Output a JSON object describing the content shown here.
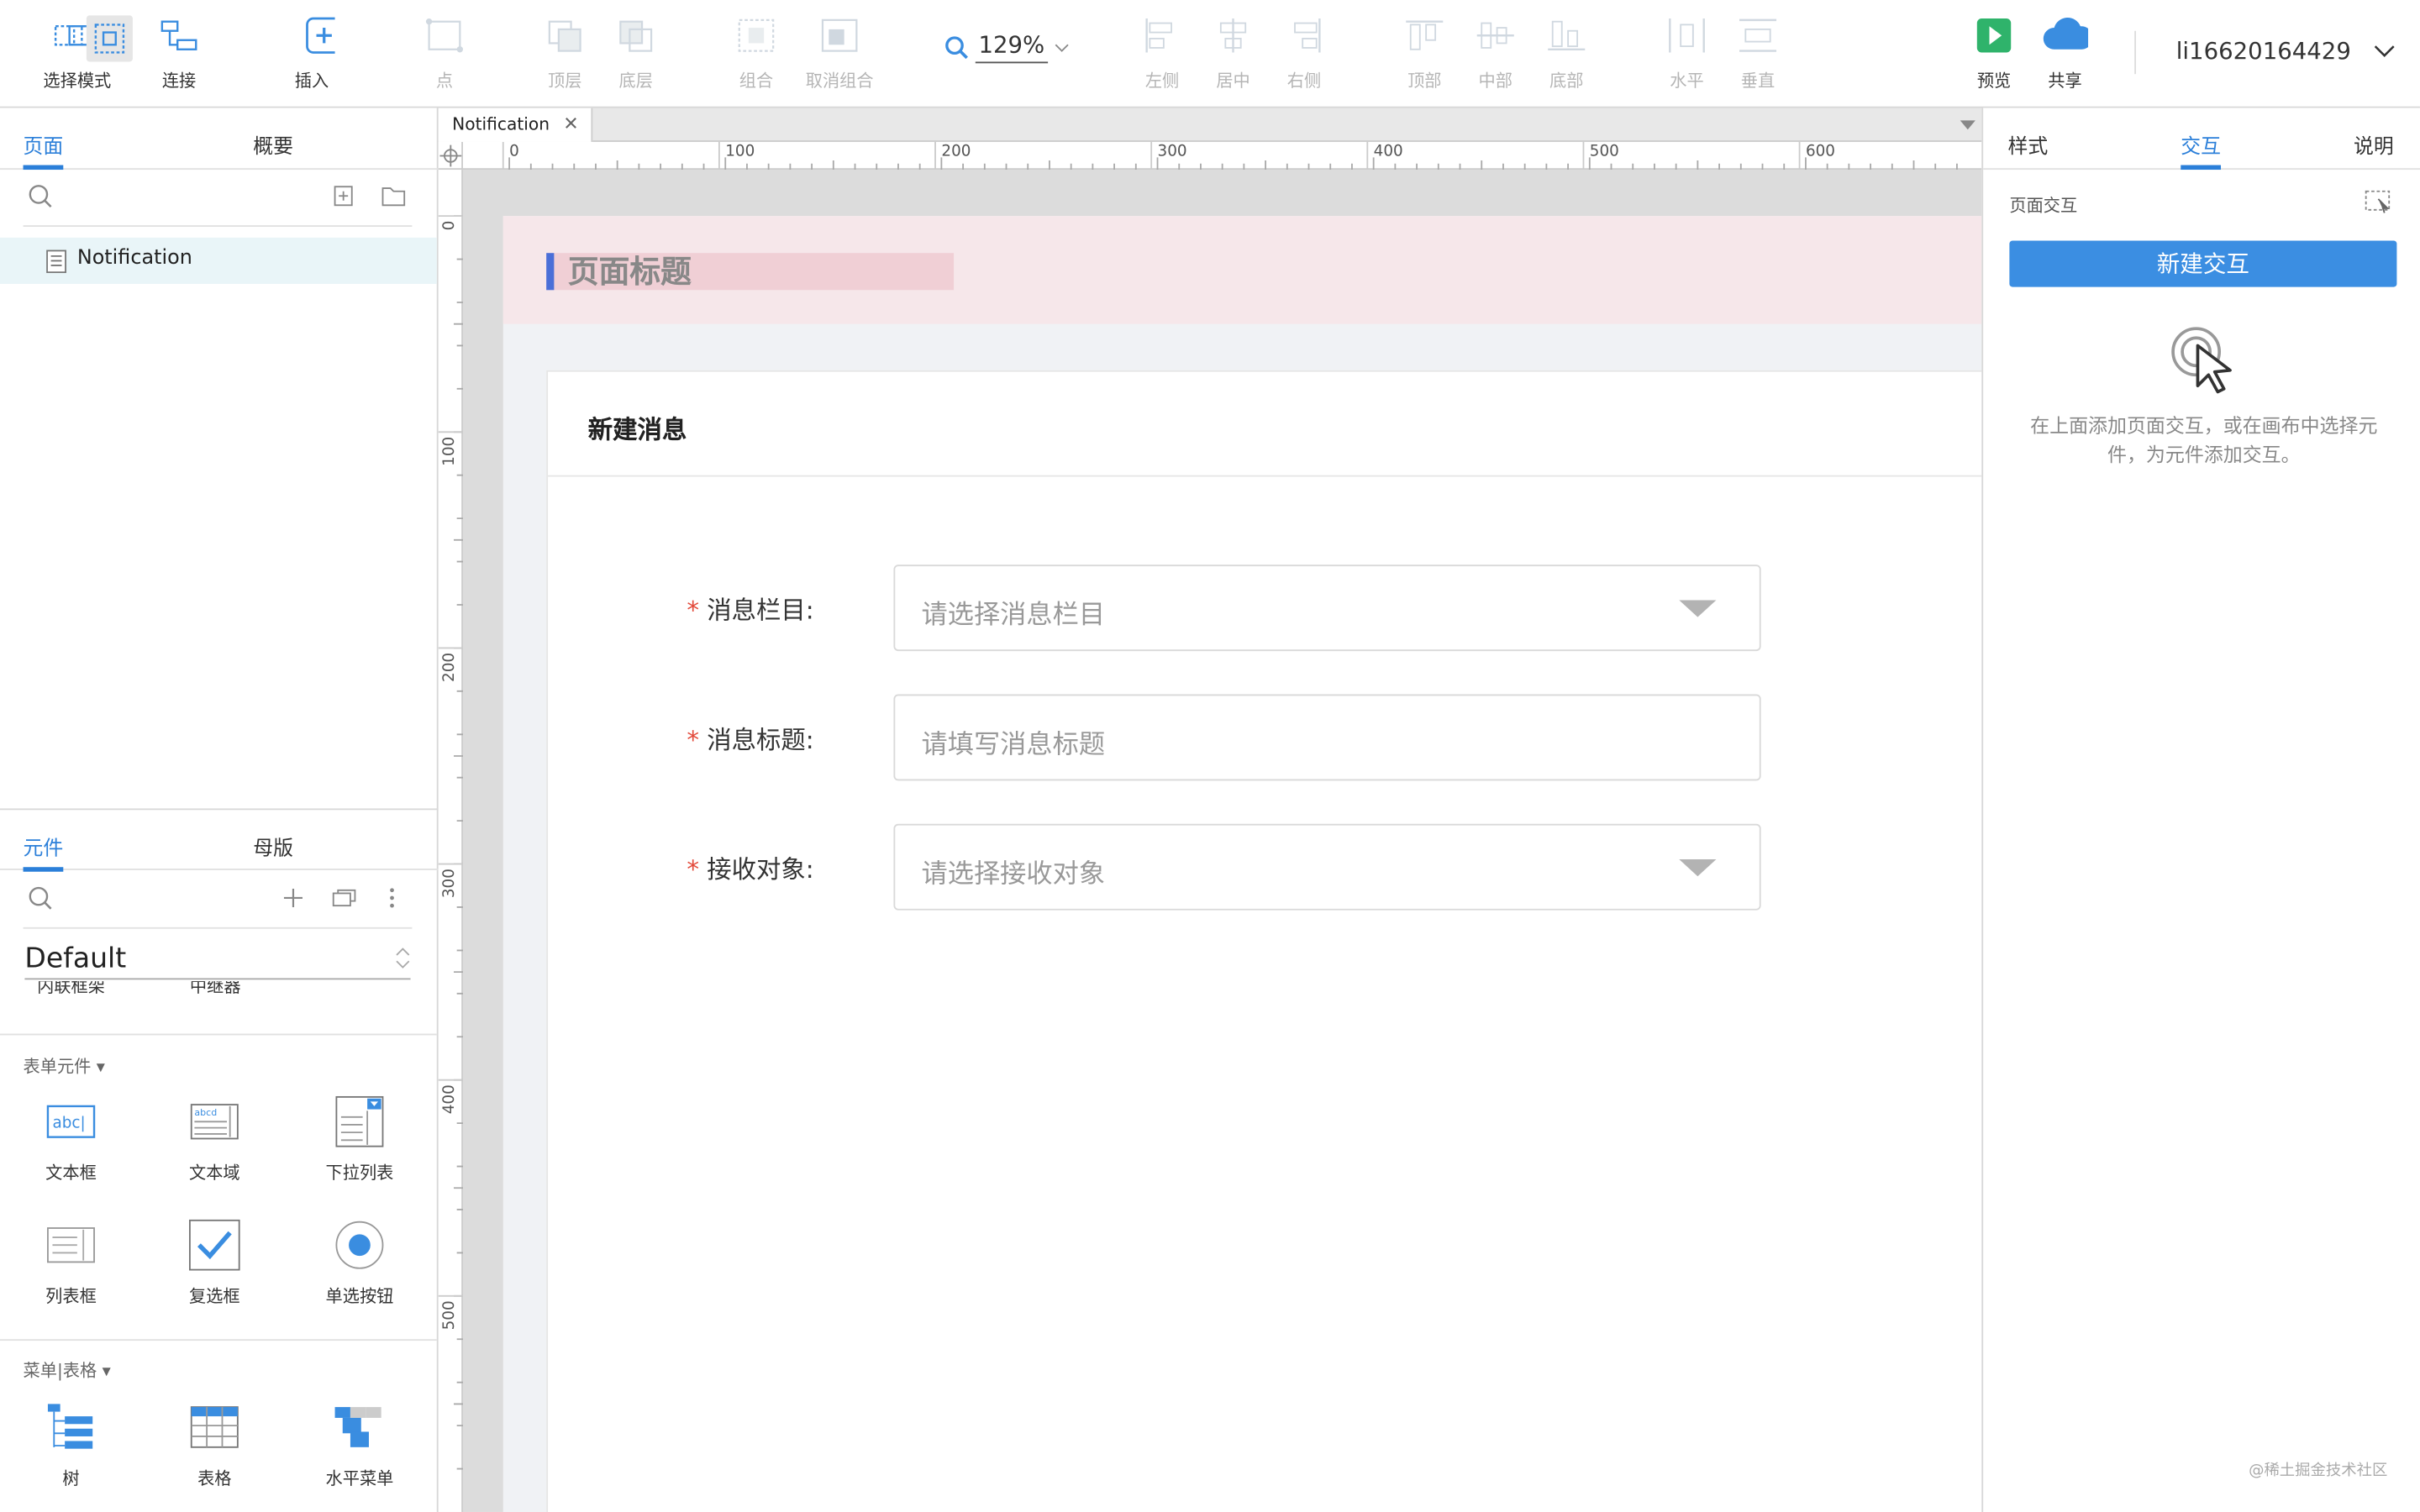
{
  "toolbar": {
    "select_mode": "选择模式",
    "connect": "连接",
    "insert": "插入",
    "point": "点",
    "top_layer": "顶层",
    "bottom_layer": "底层",
    "group": "组合",
    "ungroup": "取消组合",
    "zoom": "129%",
    "align_left": "左侧",
    "align_center": "居中",
    "align_right": "右侧",
    "align_top": "顶部",
    "align_middle": "中部",
    "align_bottom": "底部",
    "distribute_h": "水平",
    "distribute_v": "垂直",
    "preview": "预览",
    "share": "共享",
    "user": "li16620164429"
  },
  "left_panel": {
    "tabs": [
      "页面",
      "概要"
    ],
    "pages": [
      {
        "name": "Notification"
      }
    ],
    "lib_tabs": [
      "元件",
      "母版"
    ],
    "library": "Default",
    "cut_items": [
      "内联框架",
      "中继器"
    ],
    "sections": [
      {
        "title": "表单元件 ▾",
        "items": [
          "文本框",
          "文本域",
          "下拉列表",
          "列表框",
          "复选框",
          "单选按钮"
        ]
      },
      {
        "title": "菜单|表格 ▾",
        "items": [
          "树",
          "表格",
          "水平菜单"
        ]
      }
    ]
  },
  "canvas": {
    "doc_tab": "Notification",
    "hruler": [
      "0",
      "100",
      "200",
      "300",
      "400",
      "500",
      "600"
    ],
    "vruler": [
      "0",
      "100",
      "200",
      "300",
      "400",
      "500"
    ],
    "page_title": "页面标题",
    "card_title": "新建消息",
    "fields": [
      {
        "label": "消息栏目:",
        "placeholder": "请选择消息栏目",
        "dropdown": true
      },
      {
        "label": "消息标题:",
        "placeholder": "请填写消息标题",
        "dropdown": false
      },
      {
        "label": "接收对象:",
        "placeholder": "请选择接收对象",
        "dropdown": true
      }
    ],
    "required_mark": "*"
  },
  "right_panel": {
    "tabs": [
      "样式",
      "交互",
      "说明"
    ],
    "section_title": "页面交互",
    "new_interaction": "新建交互",
    "hint": "在上面添加页面交互，或在画布中选择元件，为元件添加交互。"
  },
  "watermark": "@稀土掘金技术社区",
  "colors": {
    "accent": "#2b7fd9",
    "button": "#3b8ee2",
    "required": "#e24a3b",
    "header_band": "#f6e7ea",
    "title_bar": "#4a6fd8"
  }
}
